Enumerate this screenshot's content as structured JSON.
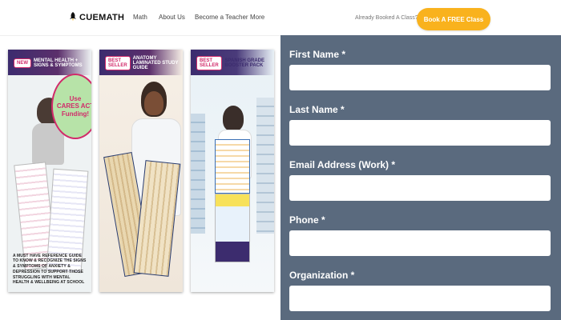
{
  "header": {
    "brand": "CUEMATH",
    "nav": [
      "Math",
      "About Us",
      "Become a Teacher",
      "More"
    ],
    "note": "Already Booked A Class?",
    "cta_label": "Book A FREE Class"
  },
  "cards": [
    {
      "badge": "NEW",
      "title": "MENTAL HEALTH + SIGNS & SYMPTOMS",
      "bubble_lines": [
        "Use",
        "CARES ACT",
        "Funding!"
      ],
      "footer": "A MUST HAVE REFERENCE GUIDE TO KNOW & RECOGNIZE THE SIGNS & SYMPTOMS OF ANXIETY & DEPRESSION TO SUPPORT THOSE STRUGGLING WITH MENTAL HEALTH & WELLBEING AT SCHOOL"
    },
    {
      "badge": "BEST SELLER",
      "title": "ANATOMY LAMINATED STUDY GUIDE"
    },
    {
      "badge": "BEST SELLER",
      "title": "SPANISH GRADE BOOSTER PACK"
    }
  ],
  "form": {
    "fields": [
      {
        "label": "First Name *",
        "value": ""
      },
      {
        "label": "Last Name *",
        "value": ""
      },
      {
        "label": "Email Address (Work) *",
        "value": ""
      },
      {
        "label": "Phone *",
        "value": ""
      },
      {
        "label": "Organization *",
        "value": ""
      }
    ]
  },
  "colors": {
    "cta": "#f9b21d",
    "form_panel": "#5a6a7e",
    "accent_pink": "#d12a6a"
  },
  "icons": {
    "logo": "rocket-icon"
  }
}
